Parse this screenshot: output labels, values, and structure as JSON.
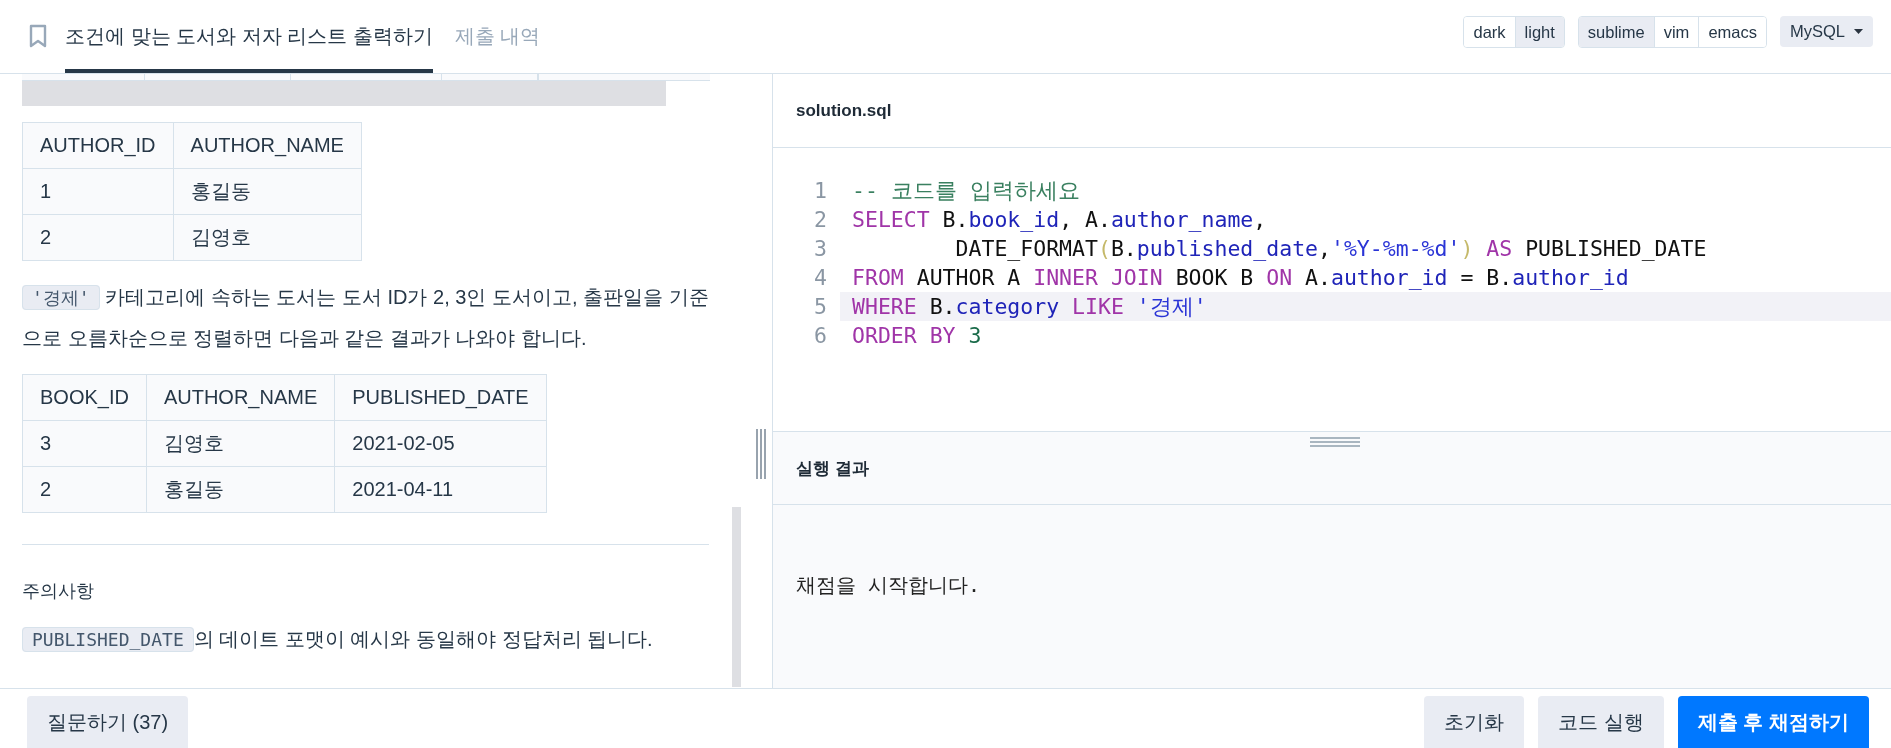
{
  "header": {
    "tabs": [
      {
        "label": "조건에 맞는 도서와 저자 리스트 출력하기",
        "selected": true
      },
      {
        "label": "제출 내역",
        "selected": false
      }
    ],
    "toggle_groups": [
      [
        {
          "label": "dark",
          "selected": false
        },
        {
          "label": "light",
          "selected": true
        }
      ],
      [
        {
          "label": "sublime",
          "selected": true
        },
        {
          "label": "vim",
          "selected": false
        },
        {
          "label": "emacs",
          "selected": false
        }
      ]
    ],
    "language": "MySQL"
  },
  "description": {
    "author_table": {
      "columns": [
        "AUTHOR_ID",
        "AUTHOR_NAME"
      ],
      "rows": [
        [
          "1",
          "홍길동"
        ],
        [
          "2",
          "김영호"
        ]
      ]
    },
    "paragraph": {
      "code": "'경제'",
      "text": "카테고리에 속하는 도서는 도서 ID가 2, 3인 도서이고, 출판일을 기준으로 오름차순으로 정렬하면 다음과 같은 결과가 나와야 합니다."
    },
    "result_table": {
      "columns": [
        "BOOK_ID",
        "AUTHOR_NAME",
        "PUBLISHED_DATE"
      ],
      "rows": [
        [
          "3",
          "김영호",
          "2021-02-05"
        ],
        [
          "2",
          "홍길동",
          "2021-04-11"
        ]
      ]
    },
    "notes_heading": "주의사항",
    "note": {
      "code": "PUBLISHED_DATE",
      "text": "의 데이트 포맷이 예시와 동일해야 정답처리 됩니다."
    }
  },
  "editor": {
    "filename": "solution.sql",
    "lines": [
      {
        "number": "1",
        "active": false,
        "tokens": [
          {
            "kind": "comment",
            "text": "-- 코드를 입력하세요"
          }
        ]
      },
      {
        "number": "2",
        "active": false,
        "tokens": [
          {
            "kind": "keyword",
            "text": "SELECT"
          },
          {
            "kind": "plain",
            "text": " B."
          },
          {
            "kind": "property",
            "text": "book_id"
          },
          {
            "kind": "plain",
            "text": ", A."
          },
          {
            "kind": "property",
            "text": "author_name"
          },
          {
            "kind": "plain",
            "text": ","
          }
        ]
      },
      {
        "number": "3",
        "active": false,
        "tokens": [
          {
            "kind": "plain",
            "text": "        DATE_FORMAT"
          },
          {
            "kind": "bracket",
            "text": "("
          },
          {
            "kind": "plain",
            "text": "B."
          },
          {
            "kind": "property",
            "text": "published_date"
          },
          {
            "kind": "plain",
            "text": ","
          },
          {
            "kind": "string",
            "text": "'%Y-%m-%d'"
          },
          {
            "kind": "bracket",
            "text": ")"
          },
          {
            "kind": "keyword",
            "text": " AS"
          },
          {
            "kind": "plain",
            "text": " PUBLISHED_DATE"
          }
        ]
      },
      {
        "number": "4",
        "active": false,
        "tokens": [
          {
            "kind": "keyword",
            "text": "FROM"
          },
          {
            "kind": "plain",
            "text": " AUTHOR A "
          },
          {
            "kind": "keyword",
            "text": "INNER JOIN"
          },
          {
            "kind": "plain",
            "text": " BOOK B "
          },
          {
            "kind": "keyword",
            "text": "ON"
          },
          {
            "kind": "plain",
            "text": " A."
          },
          {
            "kind": "property",
            "text": "author_id"
          },
          {
            "kind": "plain",
            "text": " = B."
          },
          {
            "kind": "property",
            "text": "author_id"
          }
        ]
      },
      {
        "number": "5",
        "active": true,
        "tokens": [
          {
            "kind": "keyword",
            "text": "WHERE"
          },
          {
            "kind": "plain",
            "text": " B."
          },
          {
            "kind": "property",
            "text": "category"
          },
          {
            "kind": "keyword",
            "text": " LIKE"
          },
          {
            "kind": "string",
            "text": " '경제'"
          }
        ]
      },
      {
        "number": "6",
        "active": false,
        "tokens": [
          {
            "kind": "keyword",
            "text": "ORDER BY"
          },
          {
            "kind": "number",
            "text": " 3"
          }
        ]
      }
    ]
  },
  "results": {
    "title": "실행 결과",
    "output": "채점을 시작합니다."
  },
  "footer": {
    "question_button": "질문하기 (37)",
    "buttons": [
      {
        "label": "초기화",
        "kind": "secondary"
      },
      {
        "label": "코드 실행",
        "kind": "secondary"
      },
      {
        "label": "제출 후 채점하기",
        "kind": "primary"
      }
    ]
  }
}
